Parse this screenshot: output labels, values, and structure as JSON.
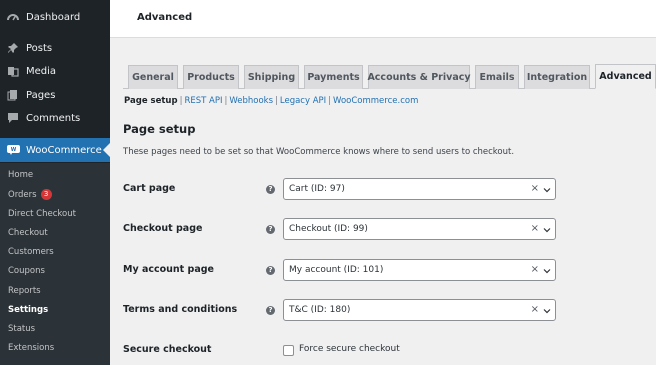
{
  "sidebar": {
    "menu": [
      {
        "label": "Dashboard",
        "icon": "dashboard-icon"
      },
      {
        "label": "Posts",
        "icon": "pin-icon"
      },
      {
        "label": "Media",
        "icon": "media-icon"
      },
      {
        "label": "Pages",
        "icon": "pages-icon"
      },
      {
        "label": "Comments",
        "icon": "comments-icon"
      },
      {
        "label": "WooCommerce",
        "icon": "woocommerce-icon"
      }
    ],
    "submenu": [
      {
        "label": "Home"
      },
      {
        "label": "Orders",
        "badge": "3"
      },
      {
        "label": "Direct Checkout"
      },
      {
        "label": "Checkout"
      },
      {
        "label": "Customers"
      },
      {
        "label": "Coupons"
      },
      {
        "label": "Reports"
      },
      {
        "label": "Settings"
      },
      {
        "label": "Status"
      },
      {
        "label": "Extensions"
      }
    ]
  },
  "header": {
    "title": "Advanced"
  },
  "tabs": [
    "General",
    "Products",
    "Shipping",
    "Payments",
    "Accounts & Privacy",
    "Emails",
    "Integration",
    "Advanced"
  ],
  "subsub": [
    "Page setup",
    "REST API",
    "Webhooks",
    "Legacy API",
    "WooCommerce.com"
  ],
  "section": {
    "title": "Page setup",
    "description": "These pages need to be set so that WooCommerce knows where to send users to checkout."
  },
  "fields": [
    {
      "label": "Cart page",
      "value": "Cart (ID: 97)"
    },
    {
      "label": "Checkout page",
      "value": "Checkout (ID: 99)"
    },
    {
      "label": "My account page",
      "value": "My account (ID: 101)"
    },
    {
      "label": "Terms and conditions",
      "value": "T&C (ID: 180)"
    }
  ],
  "secure": {
    "label": "Secure checkout",
    "checkbox_label": "Force secure checkout",
    "checked": false
  },
  "colors": {
    "sidebar": "#1d2327",
    "submenu": "#2c3338",
    "active": "#2271b1",
    "badge": "#d63638",
    "link": "#2271b1"
  }
}
